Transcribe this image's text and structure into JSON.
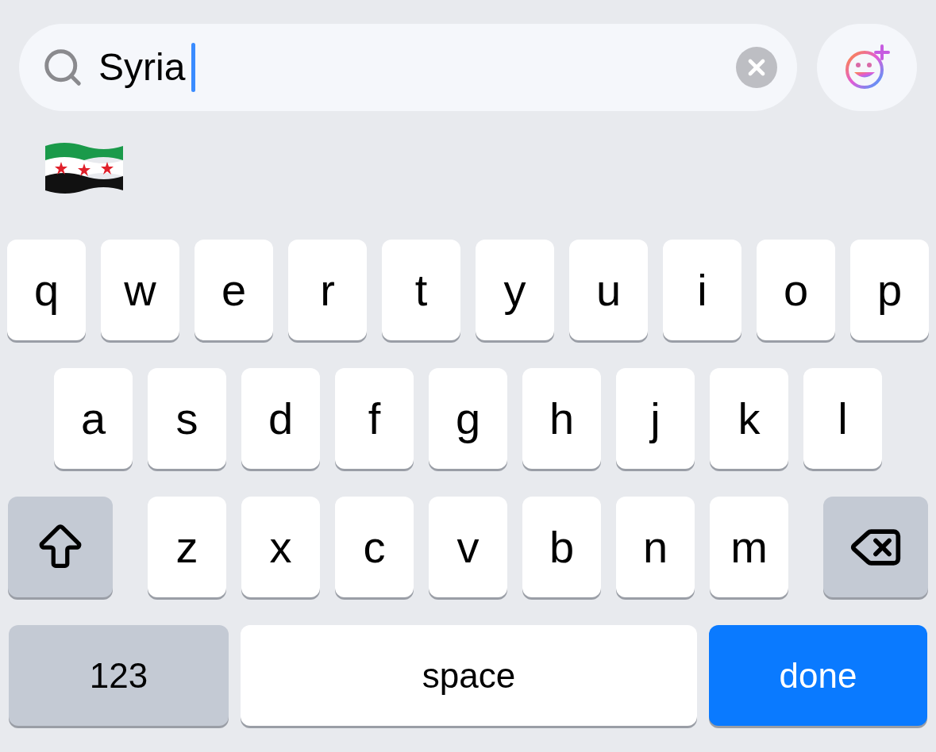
{
  "search": {
    "value": "Syria",
    "focused": true
  },
  "results": [
    {
      "kind": "flag"
    }
  ],
  "keyboard": {
    "row_1": [
      {
        "kind": "letter",
        "label": "q"
      },
      {
        "kind": "letter",
        "label": "w"
      },
      {
        "kind": "letter",
        "label": "e"
      },
      {
        "kind": "letter",
        "label": "r"
      },
      {
        "kind": "letter",
        "label": "t"
      },
      {
        "kind": "letter",
        "label": "y"
      },
      {
        "kind": "letter",
        "label": "u"
      },
      {
        "kind": "letter",
        "label": "i"
      },
      {
        "kind": "letter",
        "label": "o"
      },
      {
        "kind": "letter",
        "label": "p"
      }
    ],
    "row_2": [
      {
        "kind": "letter",
        "label": "a"
      },
      {
        "kind": "letter",
        "label": "s"
      },
      {
        "kind": "letter",
        "label": "d"
      },
      {
        "kind": "letter",
        "label": "f"
      },
      {
        "kind": "letter",
        "label": "g"
      },
      {
        "kind": "letter",
        "label": "h"
      },
      {
        "kind": "letter",
        "label": "j"
      },
      {
        "kind": "letter",
        "label": "k"
      },
      {
        "kind": "letter",
        "label": "l"
      }
    ],
    "row_3": [
      {
        "kind": "shift"
      },
      {
        "kind": "letter",
        "label": "z"
      },
      {
        "kind": "letter",
        "label": "x"
      },
      {
        "kind": "letter",
        "label": "c"
      },
      {
        "kind": "letter",
        "label": "v"
      },
      {
        "kind": "letter",
        "label": "b"
      },
      {
        "kind": "letter",
        "label": "n"
      },
      {
        "kind": "letter",
        "label": "m"
      },
      {
        "kind": "delete"
      }
    ],
    "bottom_row": [
      {
        "kind": "mode",
        "label": "123"
      },
      {
        "kind": "space",
        "label": "space"
      },
      {
        "kind": "return",
        "label": "done"
      }
    ]
  }
}
